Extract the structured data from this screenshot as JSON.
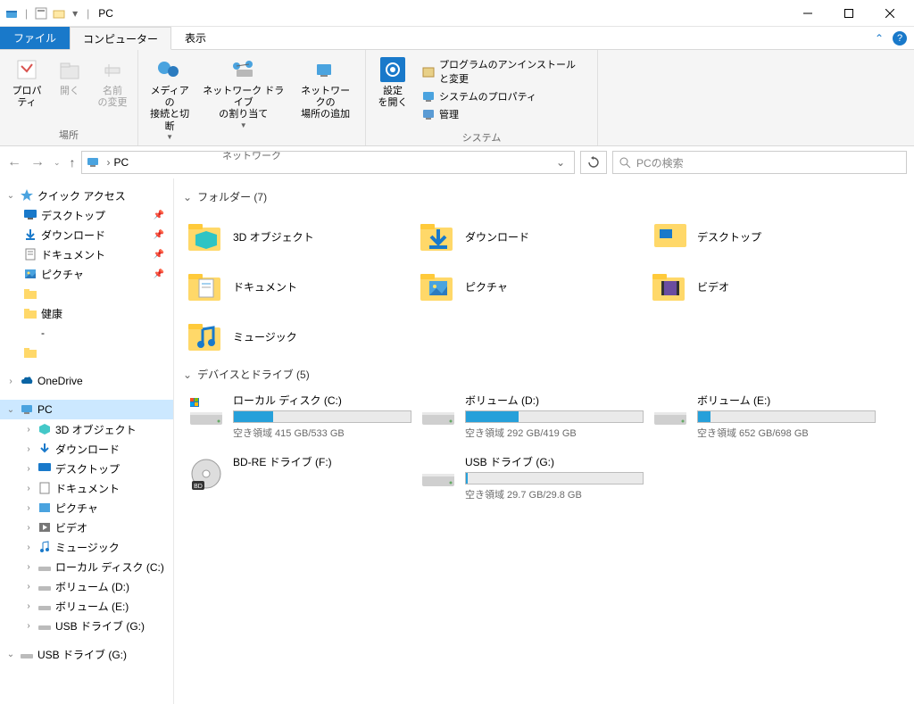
{
  "titlebar": {
    "title": "PC"
  },
  "tabs": {
    "file": "ファイル",
    "computer": "コンピューター",
    "view": "表示"
  },
  "ribbon": {
    "location": {
      "properties": "プロパティ",
      "open": "開く",
      "rename": "名前\nの変更",
      "group": "場所"
    },
    "network": {
      "media": "メディアの\n接続と切断",
      "mapdrive": "ネットワーク ドライブ\nの割り当て",
      "addloc": "ネットワークの\n場所の追加",
      "group": "ネットワーク"
    },
    "system": {
      "settings": "設定\nを開く",
      "uninstall": "プログラムのアンインストールと変更",
      "sysprops": "システムのプロパティ",
      "manage": "管理",
      "group": "システム"
    }
  },
  "nav": {
    "path": "PC",
    "search_placeholder": "PCの検索"
  },
  "sidebar": {
    "quick": "クイック アクセス",
    "desktop": "デスクトップ",
    "downloads": "ダウンロード",
    "documents": "ドキュメント",
    "pictures": "ピクチャ",
    "kenko": "健康",
    "dash": "-",
    "onedrive": "OneDrive",
    "pc": "PC",
    "objects3d": "3D オブジェクト",
    "sdownloads": "ダウンロード",
    "sdesktop": "デスクトップ",
    "sdocuments": "ドキュメント",
    "spictures": "ピクチャ",
    "svideos": "ビデオ",
    "smusic": "ミュージック",
    "localc": "ローカル ディスク (C:)",
    "vold": "ボリューム (D:)",
    "vole": "ボリューム (E:)",
    "usbg": "USB ドライブ (G:)",
    "usbg2": "USB ドライブ (G:)"
  },
  "content": {
    "folders_header": "フォルダー (7)",
    "folders": [
      {
        "name": "3D オブジェクト",
        "icon": "obj3d"
      },
      {
        "name": "ダウンロード",
        "icon": "downloads"
      },
      {
        "name": "デスクトップ",
        "icon": "desktop"
      },
      {
        "name": "ドキュメント",
        "icon": "documents"
      },
      {
        "name": "ピクチャ",
        "icon": "pictures"
      },
      {
        "name": "ビデオ",
        "icon": "videos"
      },
      {
        "name": "ミュージック",
        "icon": "music"
      }
    ],
    "drives_header": "デバイスとドライブ (5)",
    "drives": [
      {
        "name": "ローカル ディスク (C:)",
        "space": "空き領域 415 GB/533 GB",
        "fill": 22,
        "icon": "hdd-win"
      },
      {
        "name": "ボリューム (D:)",
        "space": "空き領域 292 GB/419 GB",
        "fill": 30,
        "icon": "hdd"
      },
      {
        "name": "ボリューム (E:)",
        "space": "空き領域 652 GB/698 GB",
        "fill": 7,
        "icon": "hdd"
      },
      {
        "name": "BD-RE ドライブ (F:)",
        "space": "",
        "fill": -1,
        "icon": "bd"
      },
      {
        "name": "USB ドライブ (G:)",
        "space": "空き領域 29.7 GB/29.8 GB",
        "fill": 1,
        "icon": "hdd"
      }
    ]
  }
}
